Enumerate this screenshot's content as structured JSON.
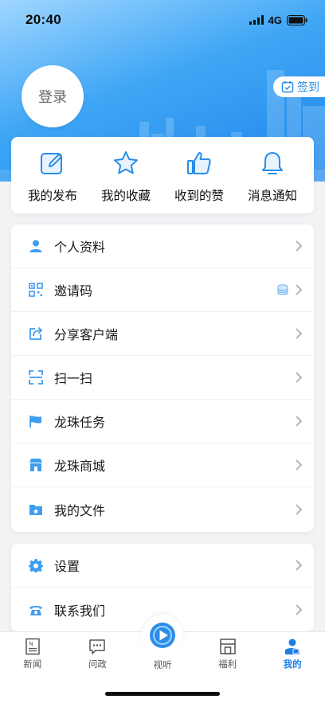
{
  "status_bar": {
    "time": "20:40",
    "network": "4G"
  },
  "profile": {
    "login_label": "登录",
    "signin_label": "签到"
  },
  "quick_actions": [
    {
      "label": "我的发布",
      "icon": "edit-icon"
    },
    {
      "label": "我的收藏",
      "icon": "star-icon"
    },
    {
      "label": "收到的赞",
      "icon": "thumbs-up-icon"
    },
    {
      "label": "消息通知",
      "icon": "bell-icon"
    }
  ],
  "menu_main": [
    {
      "label": "个人资料",
      "icon": "user-icon"
    },
    {
      "label": "邀请码",
      "icon": "qrcode-icon"
    },
    {
      "label": "分享客户端",
      "icon": "share-icon"
    },
    {
      "label": "扫一扫",
      "icon": "scan-icon"
    },
    {
      "label": "龙珠任务",
      "icon": "flag-icon"
    },
    {
      "label": "龙珠商城",
      "icon": "store-icon"
    },
    {
      "label": "我的文件",
      "icon": "folder-icon"
    }
  ],
  "menu_settings": [
    {
      "label": "设置",
      "icon": "gear-icon"
    },
    {
      "label": "联系我们",
      "icon": "phone-icon"
    }
  ],
  "tabbar": [
    {
      "label": "新闻",
      "icon": "news-icon"
    },
    {
      "label": "问政",
      "icon": "chat-icon"
    },
    {
      "label": "视听",
      "icon": "play-icon"
    },
    {
      "label": "福利",
      "icon": "gift-icon"
    },
    {
      "label": "我的",
      "icon": "profile-icon",
      "active": true
    }
  ],
  "colors": {
    "accent": "#2b8de8",
    "active_tab": "#1e7ee6"
  }
}
